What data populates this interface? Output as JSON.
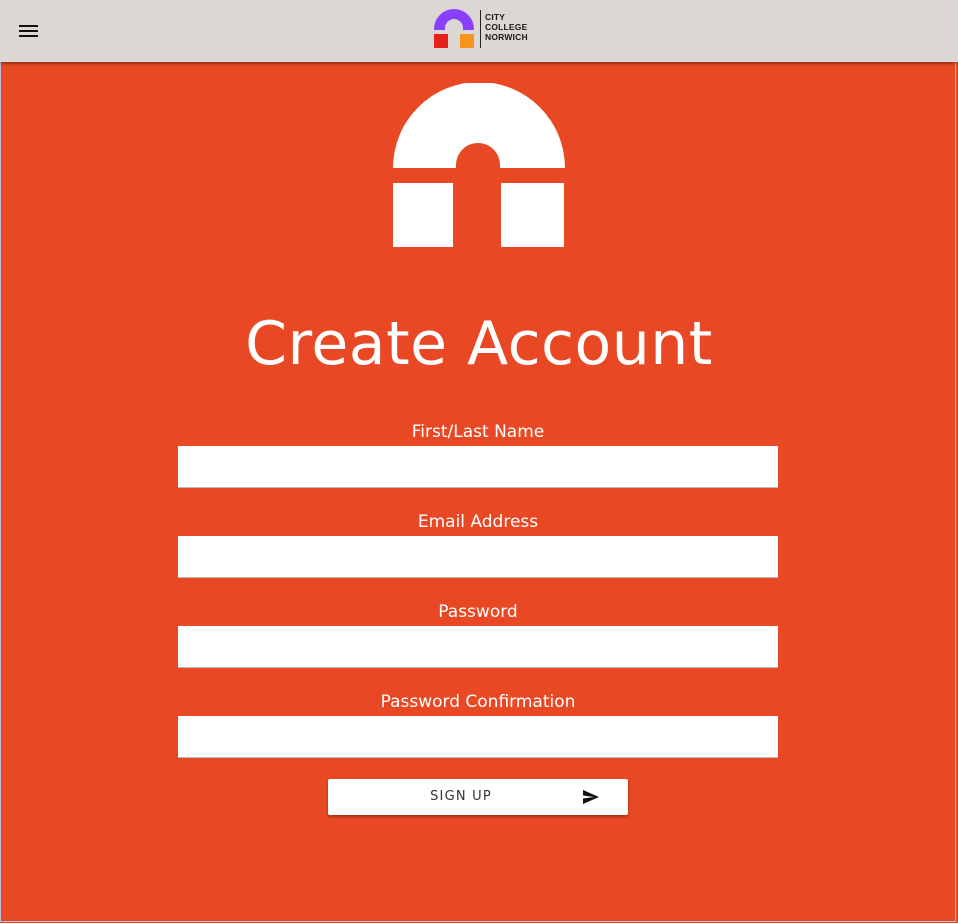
{
  "header": {
    "menu_icon": "hamburger-menu-icon",
    "brand": {
      "line1": "CITY",
      "line2": "COLLEGE",
      "line3": "NORWICH",
      "colors": {
        "arch": "#8a3ffc",
        "left_block": "#e8201a",
        "right_block": "#f7941d"
      }
    }
  },
  "page": {
    "background": "#e84924",
    "title": "Create Account"
  },
  "form": {
    "fields": [
      {
        "label": "First/Last Name",
        "value": ""
      },
      {
        "label": "Email Address",
        "value": ""
      },
      {
        "label": "Password",
        "value": ""
      },
      {
        "label": "Password Confirmation",
        "value": ""
      }
    ],
    "submit": {
      "label": "SIGN UP",
      "icon": "send-icon"
    }
  }
}
